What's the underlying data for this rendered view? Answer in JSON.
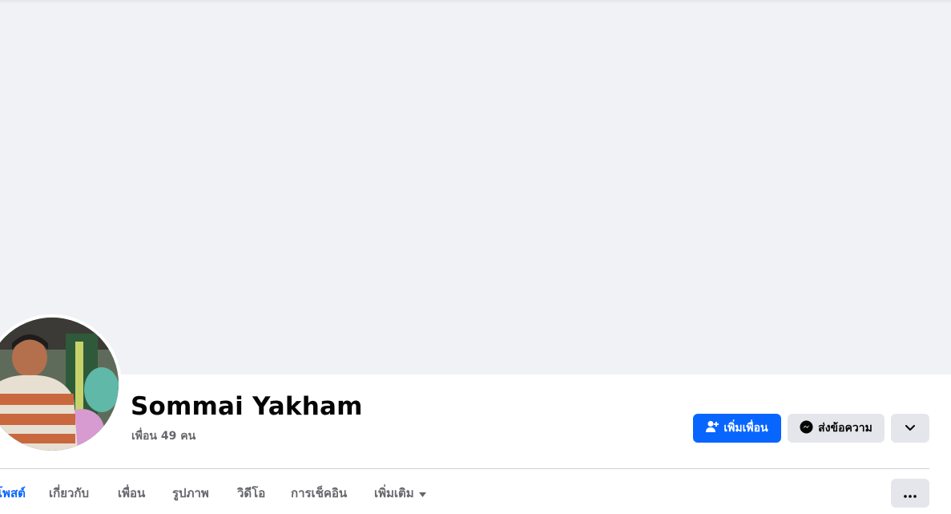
{
  "profile": {
    "name": "Sommai Yakham",
    "friends_count": "เพื่อน 49 คน"
  },
  "actions": {
    "add_friend_label": "เพิ่มเพื่อน",
    "add_friend_icon": "add-friend-icon",
    "message_label": "ส่งข้อความ",
    "message_icon": "messenger-icon",
    "more_icon": "chevron-down-icon"
  },
  "tabs": [
    {
      "label": "โพสต์",
      "active": true
    },
    {
      "label": "เกี่ยวกับ",
      "active": false
    },
    {
      "label": "เพื่อน",
      "active": false
    },
    {
      "label": "รูปภาพ",
      "active": false
    },
    {
      "label": "วิดีโอ",
      "active": false
    },
    {
      "label": "การเช็คอิน",
      "active": false
    },
    {
      "label": "เพิ่มเติม",
      "active": false,
      "icon": "caret-down-icon"
    }
  ],
  "tabs_menu_icon": "ellipsis-icon",
  "colors": {
    "accent": "#0866ff",
    "cover_bg": "#f0f2f5",
    "secondary_button": "#e4e6eb",
    "muted_text": "#65676b"
  }
}
